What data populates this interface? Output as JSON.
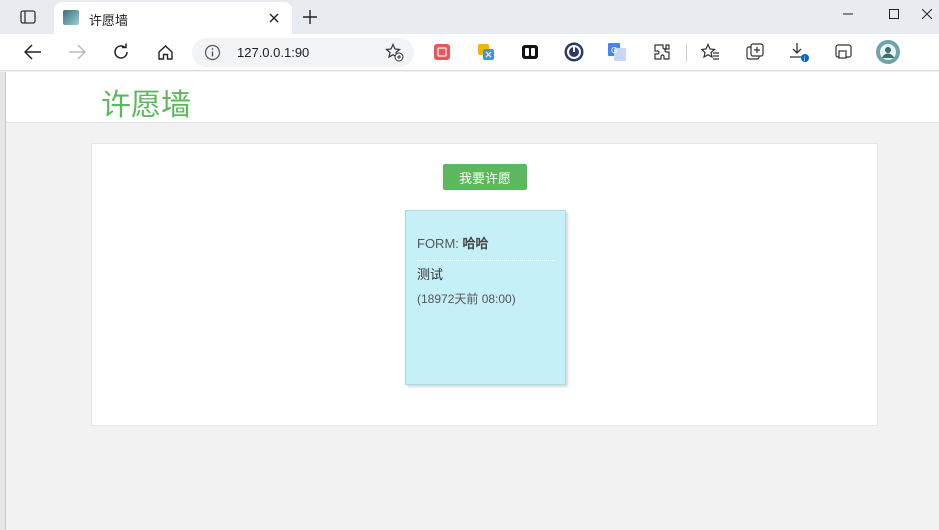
{
  "tab": {
    "title": "许愿墙"
  },
  "address": {
    "url": "127.0.0.1:90"
  },
  "page": {
    "logo": "许愿墙",
    "wish_button": "我要许愿",
    "notes": [
      {
        "from_label": "FORM:",
        "from_name": "哈哈",
        "content": "测试",
        "time": "(18972天前 08:00)"
      }
    ]
  },
  "colors": {
    "accent": "#5cb85c",
    "note_bg": "#c6f0f7"
  },
  "icons": {
    "toolbar": [
      "back-icon",
      "forward-icon",
      "refresh-icon",
      "home-icon",
      "info-icon",
      "add-favorite-icon"
    ],
    "extensions": [
      "ext-red-icon",
      "ext-translate-icon",
      "ext-tabs-icon",
      "ext-circle-icon",
      "ext-google-translate-icon",
      "extensions-icon",
      "favorites-icon",
      "collections-icon",
      "downloads-icon",
      "screenshot-icon",
      "profile-avatar"
    ]
  }
}
